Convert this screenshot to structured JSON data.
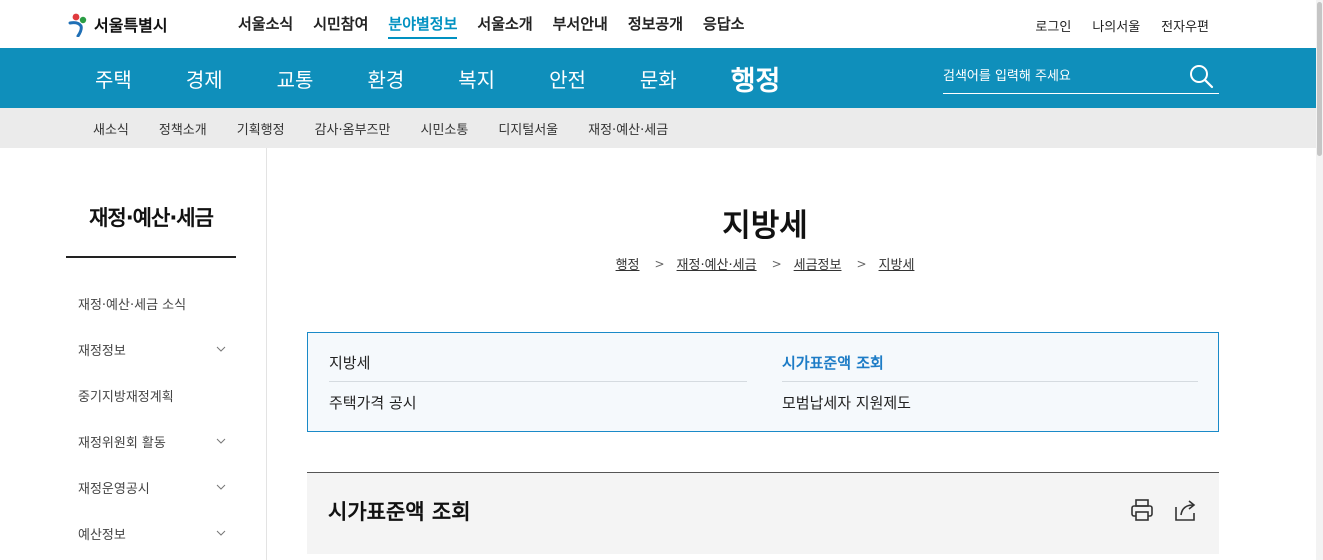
{
  "header": {
    "logo_text": "서울특별시",
    "gnb": [
      "서울소식",
      "시민참여",
      "분야별정보",
      "서울소개",
      "부서안내",
      "정보공개",
      "응답소"
    ],
    "gnb_active": "분야별정보",
    "util": [
      "로그인",
      "나의서울",
      "전자우편"
    ]
  },
  "categories": {
    "items": [
      "주택",
      "경제",
      "교통",
      "환경",
      "복지",
      "안전",
      "문화"
    ],
    "current": "행정",
    "search_placeholder": "검색어를 입력해 주세요"
  },
  "subnav": [
    "새소식",
    "정책소개",
    "기획행정",
    "감사·옴부즈만",
    "시민소통",
    "디지털서울",
    "재정·예산·세금"
  ],
  "sidebar": {
    "title": "재정·예산·세금",
    "items": [
      {
        "label": "재정·예산·세금 소식",
        "has_children": false
      },
      {
        "label": "재정정보",
        "has_children": true
      },
      {
        "label": "중기지방재정계획",
        "has_children": false
      },
      {
        "label": "재정위원회 활동",
        "has_children": true
      },
      {
        "label": "재정운영공시",
        "has_children": true
      },
      {
        "label": "예산정보",
        "has_children": true
      }
    ]
  },
  "main": {
    "title": "지방세",
    "breadcrumb": [
      "행정",
      "재정·예산·세금",
      "세금정보",
      "지방세"
    ],
    "tabs": [
      {
        "label": "지방세",
        "active": false
      },
      {
        "label": "시가표준액 조회",
        "active": true
      },
      {
        "label": "주택가격 공시",
        "active": false
      },
      {
        "label": "모범납세자 지원제도",
        "active": false
      }
    ],
    "section_title": "시가표준액 조회"
  },
  "icons": {
    "search": "search-icon",
    "print": "print-icon",
    "share": "share-icon",
    "chevron": "chevron-down-icon"
  },
  "colors": {
    "brand_blue": "#0f8fbb",
    "active_link": "#0091c1",
    "tab_active": "#1d7cc6",
    "tab_border": "#1a8ac8"
  }
}
